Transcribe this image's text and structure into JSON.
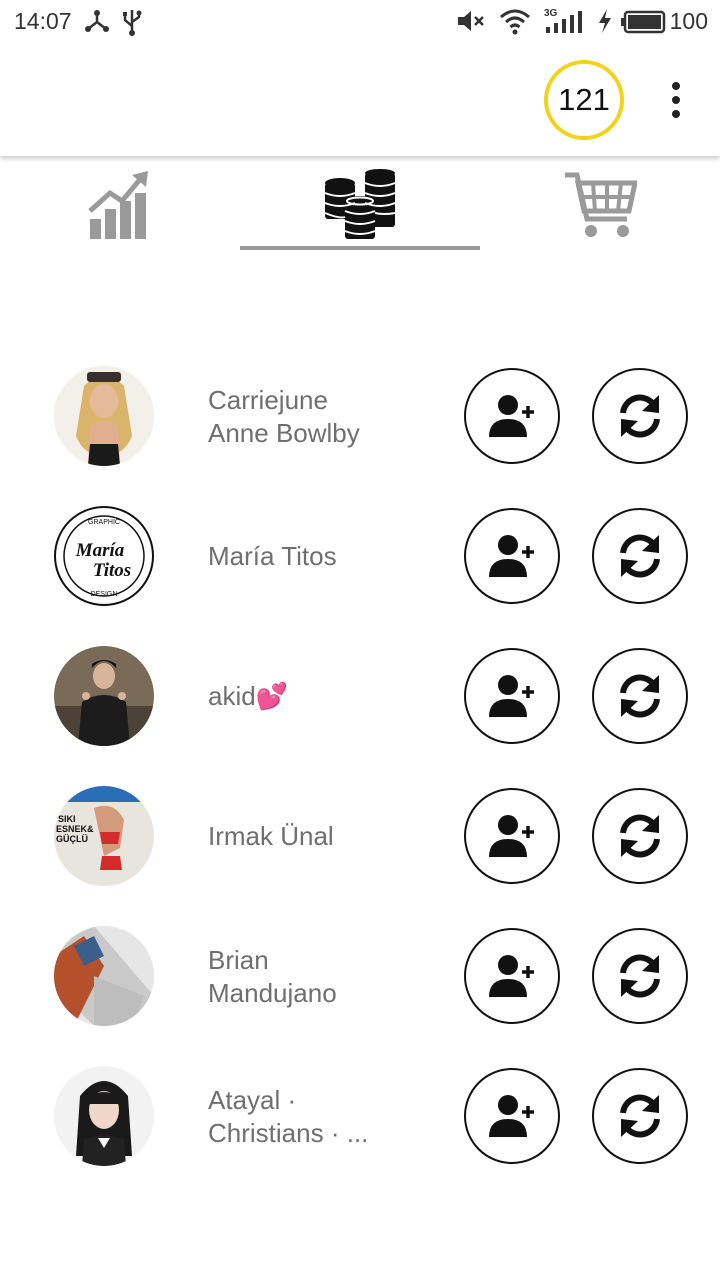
{
  "status_bar": {
    "time": "14:07",
    "network": "3G",
    "battery": "100",
    "icons": [
      "share-icon",
      "usb-icon",
      "mute-icon",
      "wifi-icon",
      "signal-icon",
      "charging-icon",
      "battery-icon"
    ]
  },
  "appbar": {
    "coin_count": "121",
    "coin_ring_color": "#f2d21b",
    "menu_icon": "more-vert-icon"
  },
  "tabs": [
    {
      "icon": "stats-chart-icon",
      "selected": false
    },
    {
      "icon": "coins-stack-icon",
      "selected": true
    },
    {
      "icon": "shopping-cart-icon",
      "selected": false
    }
  ],
  "users": [
    {
      "name_line1": "Carriejune",
      "name_line2": "Anne Bowlby"
    },
    {
      "name_line1": "María Titos",
      "name_line2": ""
    },
    {
      "name_line1": "akid💕",
      "name_line2": ""
    },
    {
      "name_line1": "Irmak Ünal",
      "name_line2": ""
    },
    {
      "name_line1": "Brian",
      "name_line2": "Mandujano"
    },
    {
      "name_line1": "Atayal ·",
      "name_line2": "Christians · ..."
    }
  ],
  "logo_text": {
    "top": "GRAPHIC",
    "main1": "María",
    "main2": "Titos",
    "bottom": "DESIGN"
  },
  "magazine_text": [
    "SIKI",
    "ESNEK&",
    "GÜÇLÜ"
  ],
  "row_actions": {
    "follow_icon": "person-add-icon",
    "refresh_icon": "refresh-icon"
  }
}
